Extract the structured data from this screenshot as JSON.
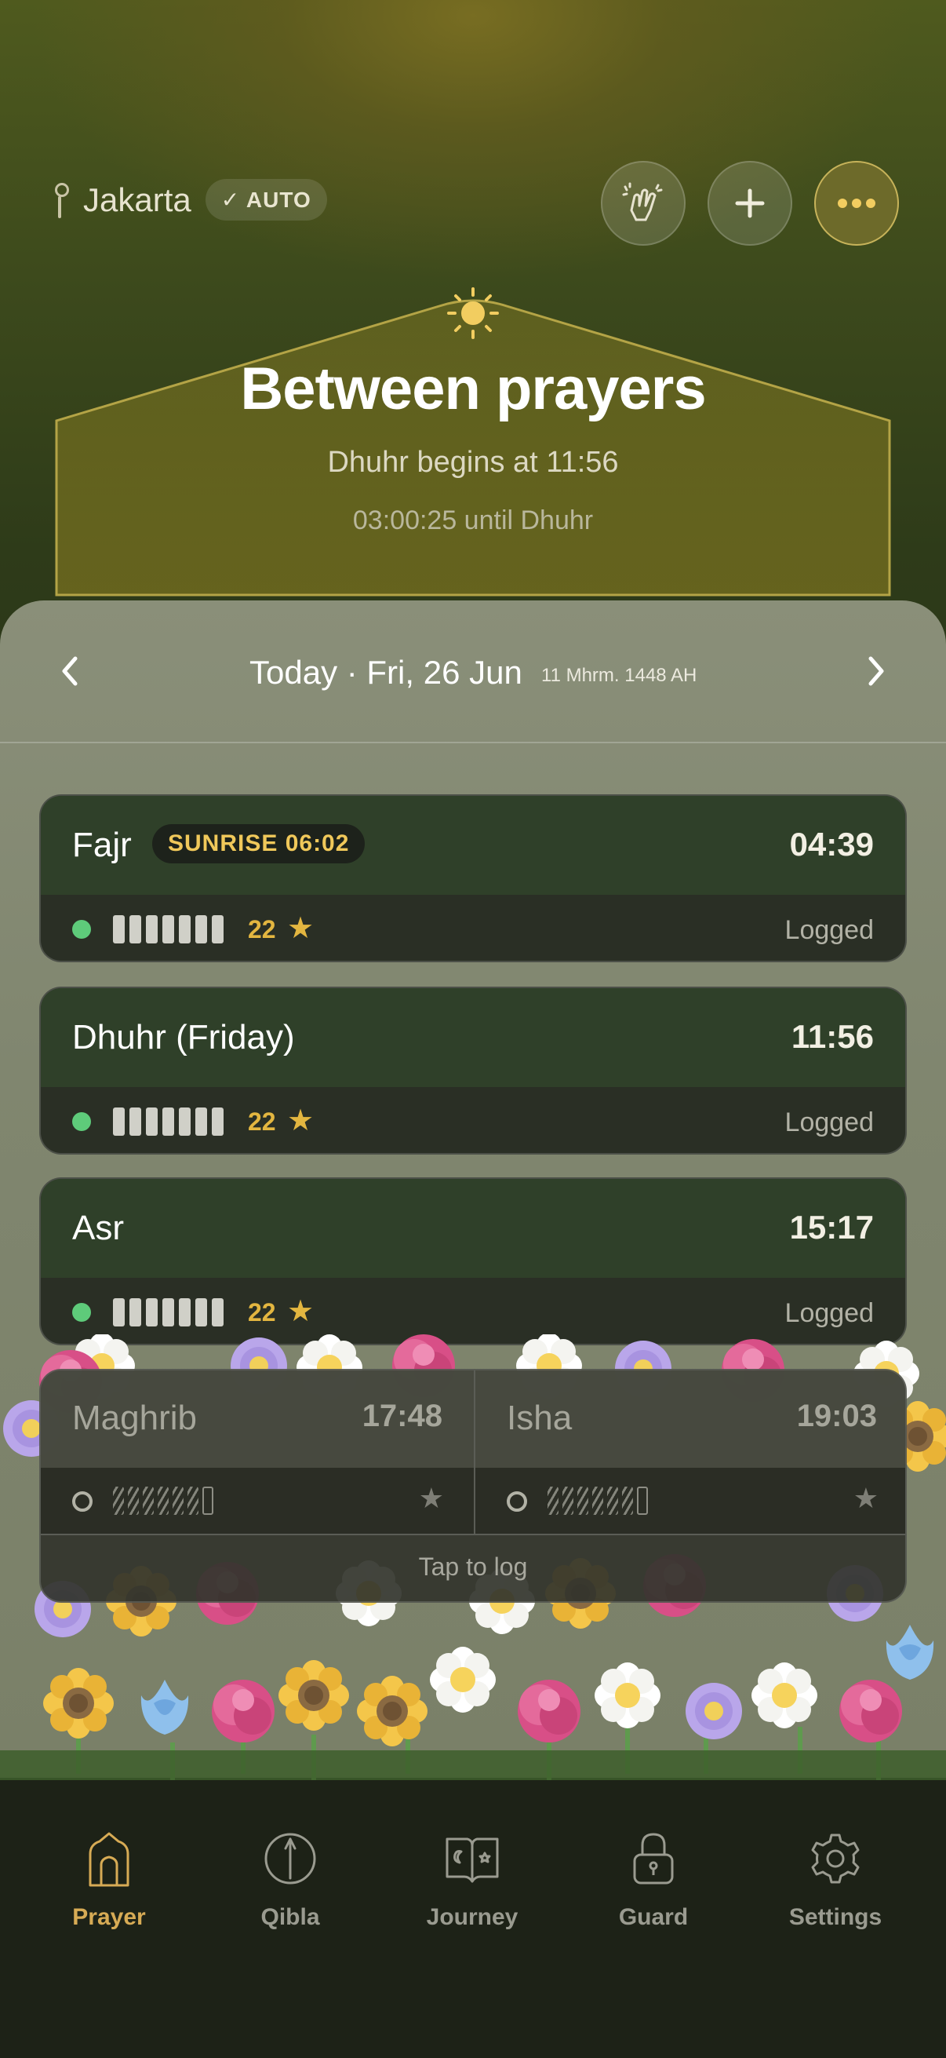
{
  "header": {
    "city": "Jakarta",
    "auto_label": "✓ AUTO",
    "buttons": [
      {
        "icon": "praying-hands-icon"
      },
      {
        "icon": "plus-icon"
      },
      {
        "icon": "more-icon"
      }
    ]
  },
  "hero": {
    "title": "Between prayers",
    "subtitle": "Dhuhr begins at 11:56",
    "countdown": "03:00:25 until Dhuhr"
  },
  "date_bar": {
    "date": "Today · Fri, 26 Jun",
    "hijri": "11 Mhrm. 1448 AH"
  },
  "prayers": [
    {
      "name": "Fajr",
      "time": "04:39",
      "badge": "SUNRISE 06:02",
      "points": "22",
      "status": "Logged"
    },
    {
      "name": "Dhuhr (Friday)",
      "time": "11:56",
      "points": "22",
      "status": "Logged"
    },
    {
      "name": "Asr",
      "time": "15:17",
      "points": "22",
      "status": "Logged"
    }
  ],
  "upcoming": [
    {
      "name": "Maghrib",
      "time": "17:48"
    },
    {
      "name": "Isha",
      "time": "19:03"
    }
  ],
  "upcoming_action": "Tap to log",
  "tabs": [
    {
      "label": "Prayer",
      "icon": "mosque-icon",
      "active": true
    },
    {
      "label": "Qibla",
      "icon": "compass-icon"
    },
    {
      "label": "Journey",
      "icon": "book-icon"
    },
    {
      "label": "Guard",
      "icon": "lock-icon"
    },
    {
      "label": "Settings",
      "icon": "gear-icon"
    }
  ],
  "colors": {
    "accent_gold": "#e3b640",
    "logged_green": "#5ecb7a",
    "card_green": "#2f4029",
    "tab_active": "#d7ab55"
  }
}
